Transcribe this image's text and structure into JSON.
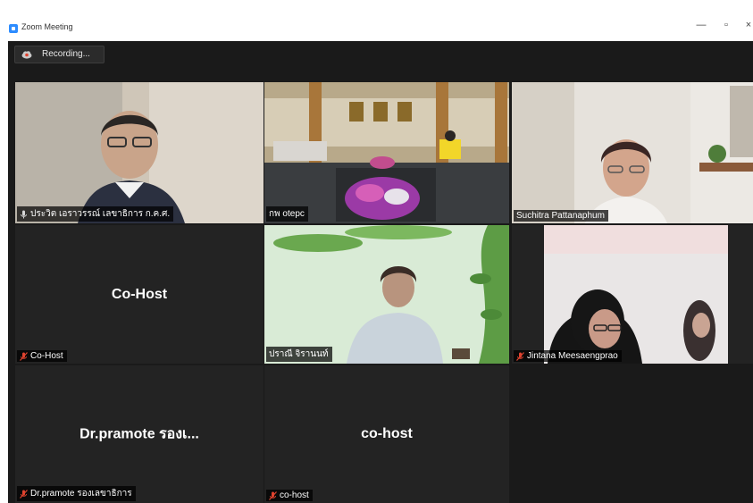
{
  "window": {
    "title": "Zoom Meeting",
    "minimize_glyph": "—",
    "maximize_glyph": "▫",
    "close_glyph": "×"
  },
  "recording": {
    "label": "Recording..."
  },
  "colors": {
    "active_speaker": "#c7e34a",
    "muted_icon": "#e0432f",
    "tile_bg": "#232323",
    "meeting_bg": "#1a1a1a"
  },
  "participants": [
    {
      "name": "ประวิต เอราวรรณ์ เลขาธิการ ก.ค.ศ.",
      "video": true,
      "muted": false,
      "active": true
    },
    {
      "name": "กพ otepc",
      "video": true,
      "muted": false,
      "active": false
    },
    {
      "name": "Suchitra Pattanaphum",
      "video": true,
      "muted": false,
      "active": false
    },
    {
      "name": "Co-Host",
      "display": "Co-Host",
      "video": false,
      "muted": true,
      "active": false
    },
    {
      "name": "ปราณี จิรานนท์",
      "video": true,
      "muted": false,
      "active": false
    },
    {
      "name": "Jintana Meesaengprao",
      "video": true,
      "muted": true,
      "active": false
    },
    {
      "name": "Dr.pramote รองเลขาธิการ",
      "display": "Dr.pramote รองเ...",
      "video": false,
      "muted": true,
      "active": false
    },
    {
      "name": "co-host",
      "display": "co-host",
      "video": false,
      "muted": true,
      "active": false
    }
  ]
}
